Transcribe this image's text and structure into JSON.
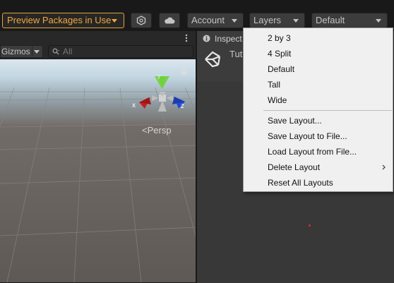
{
  "toolbar": {
    "preview_label": "Preview Packages in Use",
    "account_label": "Account",
    "layers_label": "Layers",
    "layout_label": "Default",
    "icons": [
      "package-manager-icon",
      "cloud-icon"
    ]
  },
  "scene": {
    "gizmos_label": "Gizmos",
    "search_placeholder": "All",
    "projection_label": "<Persp",
    "axis_labels": {
      "x": "x",
      "y": "y",
      "z": "z"
    }
  },
  "inspector": {
    "tab_label": "Inspect",
    "title_text": "Tut"
  },
  "layout_menu": {
    "items": [
      {
        "label": "2 by 3"
      },
      {
        "label": "4 Split"
      },
      {
        "label": "Default"
      },
      {
        "label": "Tall"
      },
      {
        "label": "Wide"
      },
      {
        "label": "Save Layout..."
      },
      {
        "label": "Save Layout to File..."
      },
      {
        "label": "Load Layout from File..."
      },
      {
        "label": "Delete Layout"
      },
      {
        "label": "Reset All Layouts"
      }
    ]
  },
  "colors": {
    "accent_orange": "#f0a93b",
    "toolbar_bg": "#191919",
    "panel_bg": "#383838",
    "menu_bg": "#f0f0f0"
  }
}
